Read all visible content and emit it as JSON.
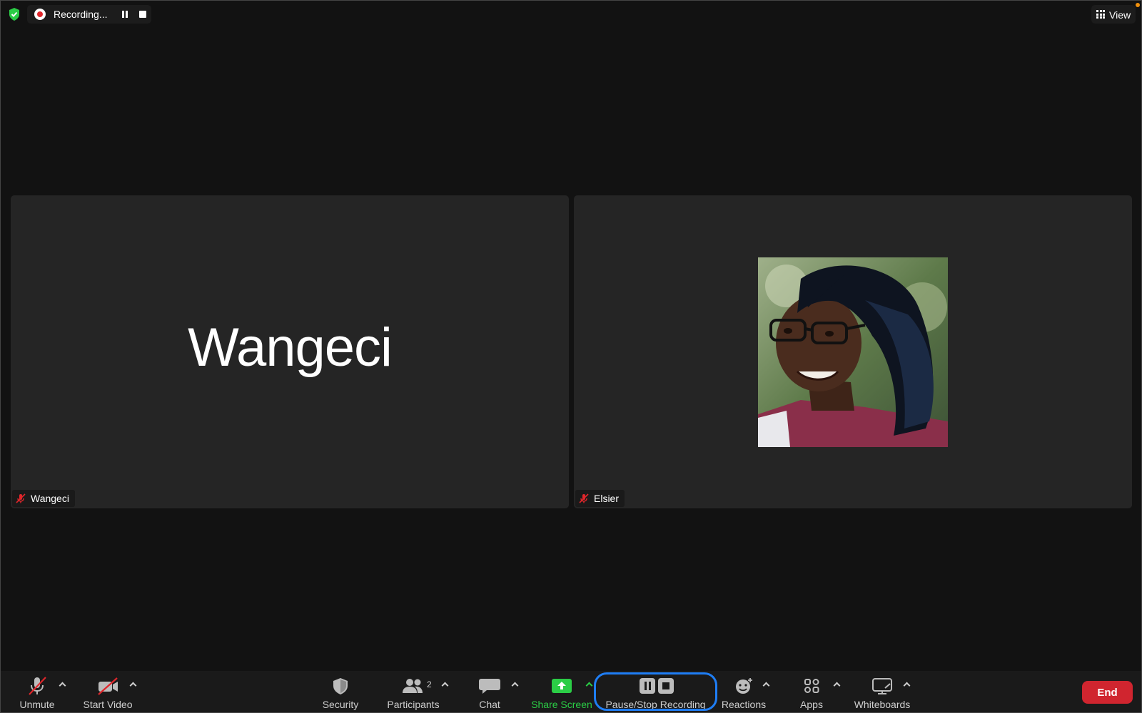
{
  "top_bar": {
    "recording_label": "Recording...",
    "view_label": "View"
  },
  "tiles": [
    {
      "display_name": "Wangeci",
      "name_tag": "Wangeci",
      "muted": true,
      "video": false
    },
    {
      "display_name": "Elsier",
      "name_tag": "Elsier",
      "muted": true,
      "video": false,
      "has_profile_photo": true
    }
  ],
  "toolbar": {
    "unmute_label": "Unmute",
    "start_video_label": "Start Video",
    "security_label": "Security",
    "participants_label": "Participants",
    "participants_count": "2",
    "chat_label": "Chat",
    "share_screen_label": "Share Screen",
    "recording_control_label": "Pause/Stop Recording",
    "reactions_label": "Reactions",
    "apps_label": "Apps",
    "whiteboards_label": "Whiteboards",
    "end_label": "End"
  },
  "colors": {
    "recording_red": "#e0262b",
    "share_green": "#2bcd46",
    "end_red": "#d0252f",
    "highlight_blue": "#1f7ef5",
    "security_green": "#2bcd46"
  },
  "icons": [
    "shield-check-icon",
    "record-dot-icon",
    "pause-icon",
    "stop-icon",
    "grid-icon",
    "mic-off-icon",
    "video-off-icon",
    "security-shield-icon",
    "participants-icon",
    "chat-icon",
    "share-screen-icon",
    "reactions-icon",
    "apps-icon",
    "whiteboard-icon",
    "chevron-up-icon"
  ]
}
